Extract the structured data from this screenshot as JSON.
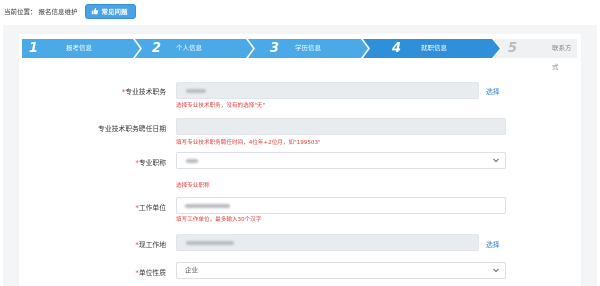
{
  "breadcrumb": {
    "prefix": "当前位置：",
    "current": "报名信息维护",
    "faq_button": "常见问题"
  },
  "steps": [
    {
      "num": "1",
      "label": "报考信息",
      "state": "done"
    },
    {
      "num": "2",
      "label": "个人信息",
      "state": "done"
    },
    {
      "num": "3",
      "label": "学历信息",
      "state": "done"
    },
    {
      "num": "4",
      "label": "就职信息",
      "state": "current"
    },
    {
      "num": "5",
      "label": "联系方式",
      "state": "todo"
    }
  ],
  "form": {
    "title": {
      "label": "专业技术职务",
      "required": true,
      "hint": "选择专业技术职务，没有的选择\"无\"",
      "action": "选择"
    },
    "appoint_date": {
      "label": "专业技术职务聘任日期",
      "required": false,
      "hint": "填写专业技术职务聘任时间，4位年+2位月，如\"199503\""
    },
    "qualification": {
      "label": "专业职称",
      "required": true,
      "hint": "选择专业职称"
    },
    "work_unit": {
      "label": "工作单位",
      "required": true,
      "hint": "填写工作单位，最多输入30个汉字"
    },
    "work_location": {
      "label": "现工作地",
      "required": true,
      "action": "选择"
    },
    "unit_type": {
      "label": "单位性质",
      "required": true,
      "value": "企业"
    }
  },
  "colors": {
    "accent": "#4aa1e8",
    "step_done": "#4aa9e6",
    "step_current": "#2f8fd9",
    "step_todo": "#f0f1f3",
    "required": "#e23a3a",
    "link": "#2f7bd1"
  },
  "icons": {
    "faq": "thumb-icon",
    "select": "chevron-down-icon"
  }
}
